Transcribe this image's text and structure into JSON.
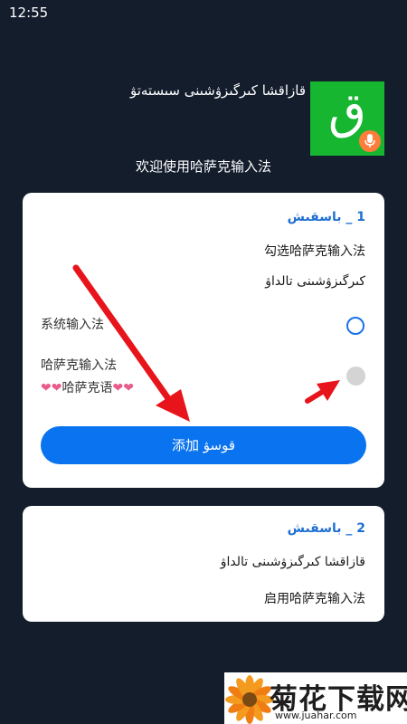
{
  "status_bar": {
    "time": "12:55"
  },
  "header": {
    "app_title": "قازاقشا كىرگىزۋشىنى سىستەتۋ",
    "app_icon_glyph": "ق",
    "icon_colors": {
      "background": "#17b631",
      "mic_badge": "#ff7d3b"
    }
  },
  "welcome_text": "欢迎使用哈萨克输入法",
  "step1": {
    "title": "1 _ باسقىش",
    "instruction_cn": "勾选哈萨克输入法",
    "instruction_kk": "كىرگىزۋشىنى تالداۋ",
    "options": [
      {
        "label": "系统输入法",
        "selected": true
      },
      {
        "label": "哈萨克输入法",
        "selected": false
      }
    ],
    "hearts_text": "哈萨克语",
    "heart_glyph": "❤",
    "add_button_label": "添加 قوسۋ"
  },
  "step2": {
    "title": "2 _ باسقىش",
    "instruction_kk": "قازاقشا كىرگىزۋشىنى تالداۋ",
    "instruction_cn": "启用哈萨克输入法"
  },
  "watermark": {
    "title": "菊花下载网",
    "url": "www.juahar.com",
    "icon": "chrysanthemum-logo"
  },
  "colors": {
    "page_background": "#131d2c",
    "accent_blue": "#0a73ef",
    "step_title_blue": "#1f6fd1",
    "annotation_arrow_red": "#e8141b"
  }
}
